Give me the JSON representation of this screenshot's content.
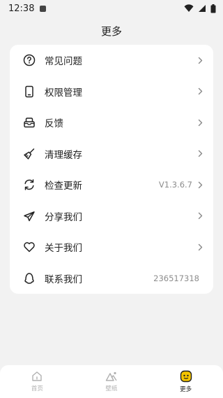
{
  "status_bar": {
    "time": "12:38"
  },
  "header": {
    "title": "更多"
  },
  "menu": {
    "items": [
      {
        "label": "常见问题",
        "value": ""
      },
      {
        "label": "权限管理",
        "value": ""
      },
      {
        "label": "反馈",
        "value": ""
      },
      {
        "label": "清理缓存",
        "value": ""
      },
      {
        "label": "检查更新",
        "value": "V1.3.6.7"
      },
      {
        "label": "分享我们",
        "value": ""
      },
      {
        "label": "关于我们",
        "value": ""
      },
      {
        "label": "联系我们",
        "value": "236517318"
      }
    ]
  },
  "tabbar": {
    "tabs": [
      {
        "label": "首页",
        "icon": "home-icon"
      },
      {
        "label": "壁纸",
        "icon": "wallpaper-icon"
      },
      {
        "label": "更多",
        "icon": "more-icon"
      }
    ],
    "active_color": "#f5c400"
  }
}
